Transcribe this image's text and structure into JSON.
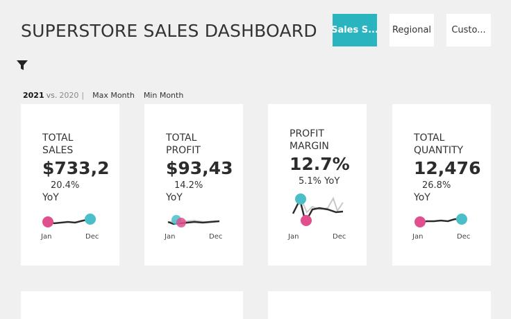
{
  "header": {
    "title": "SUPERSTORE SALES DASHBOARD",
    "tabs": [
      {
        "label": "Sales S...",
        "active": true
      },
      {
        "label": "Regional",
        "active": false
      },
      {
        "label": "Custo...",
        "active": false
      }
    ]
  },
  "filter_icon": "filter-icon",
  "controls": {
    "current_year": "2021",
    "vs": "vs.",
    "previous_year": "2020",
    "separator": "|",
    "max_month": "Max Month",
    "min_month": "Min Month"
  },
  "colors": {
    "accent": "#2ab4bf",
    "max_marker": "#4bbfc9",
    "min_marker": "#e0508f",
    "current_line": "#2c2c2c",
    "previous_line": "#c8c8c8"
  },
  "kpis": [
    {
      "label": "TOTAL\nSALES",
      "value": "$733,2",
      "yoy_pct": "20.4%",
      "yoy_word": "YoY",
      "month_start": "Jan",
      "month_end": "Dec"
    },
    {
      "label": "TOTAL\nPROFIT",
      "value": "$93,43",
      "yoy_pct": "14.2%",
      "yoy_word": "YoY",
      "month_start": "Jan",
      "month_end": "Dec"
    },
    {
      "label": "PROFIT\nMARGIN",
      "value": "12.7%",
      "yoy_pct": "5.1% YoY",
      "yoy_word": "",
      "month_start": "Jan",
      "month_end": "Dec"
    },
    {
      "label": "TOTAL\nQUANTITY",
      "value": "12,476",
      "yoy_pct": "26.8%",
      "yoy_word": "YoY",
      "month_start": "Jan",
      "month_end": "Dec"
    }
  ]
}
